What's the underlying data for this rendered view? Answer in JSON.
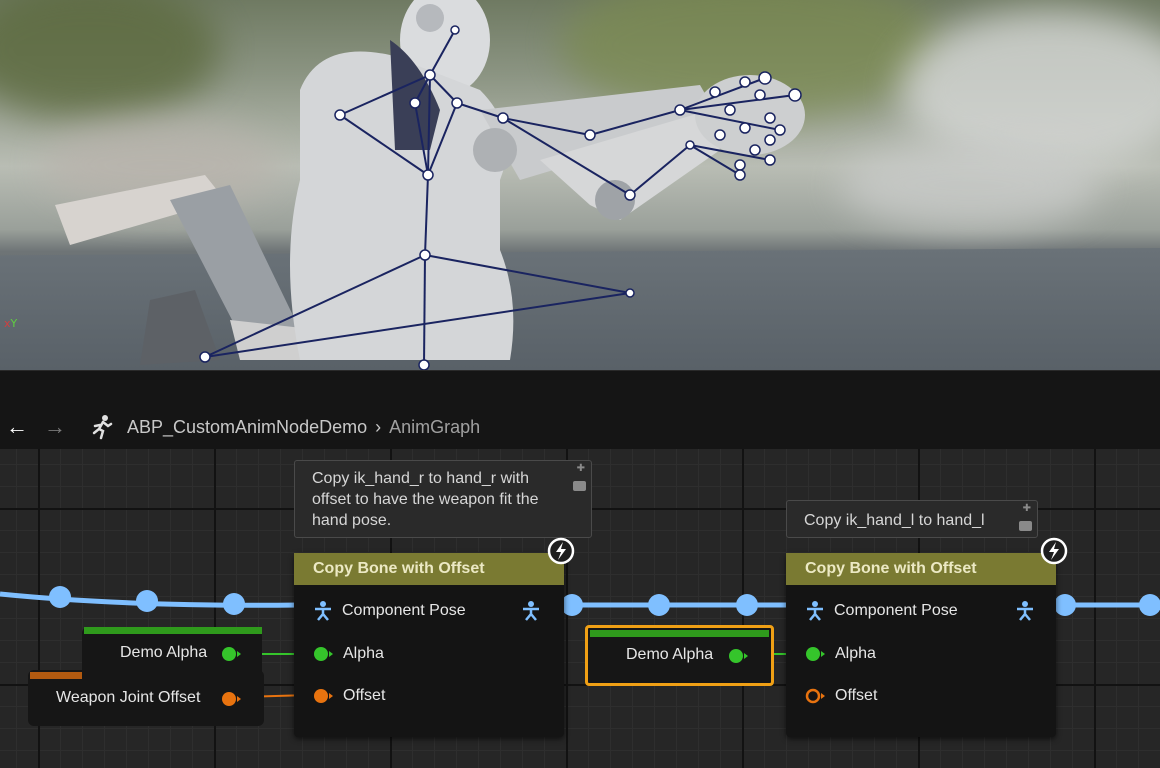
{
  "viewport": {
    "axis_x": "x",
    "axis_y": "Y"
  },
  "breadcrumb": {
    "back_icon": "←",
    "forward_icon": "→",
    "anim_blueprint_icon": "running-person-icon",
    "asset": "ABP_CustomAnimNodeDemo",
    "separator": "›",
    "graph": "AnimGraph"
  },
  "comments": {
    "right_hand": "Copy ik_hand_r to hand_r with offset to have the weapon fit the hand pose.",
    "left_hand": "Copy ik_hand_l to hand_l"
  },
  "nodes": {
    "copy_bone_1": {
      "title": "Copy Bone with Offset",
      "pin_component_pose": "Component Pose",
      "pin_alpha": "Alpha",
      "pin_offset": "Offset"
    },
    "copy_bone_2": {
      "title": "Copy Bone with Offset",
      "pin_component_pose": "Component Pose",
      "pin_alpha": "Alpha",
      "pin_offset": "Offset"
    },
    "demo_alpha_1": {
      "label": "Demo Alpha"
    },
    "weapon_joint_offset": {
      "label": "Weapon Joint Offset"
    },
    "demo_alpha_2": {
      "label": "Demo Alpha"
    }
  },
  "colors": {
    "pose_wire": "#7fbfff",
    "float_pin": "#35c52b",
    "struct_pin": "#e8730f",
    "node_header": "#7a7a32",
    "selection": "#f0a015"
  }
}
